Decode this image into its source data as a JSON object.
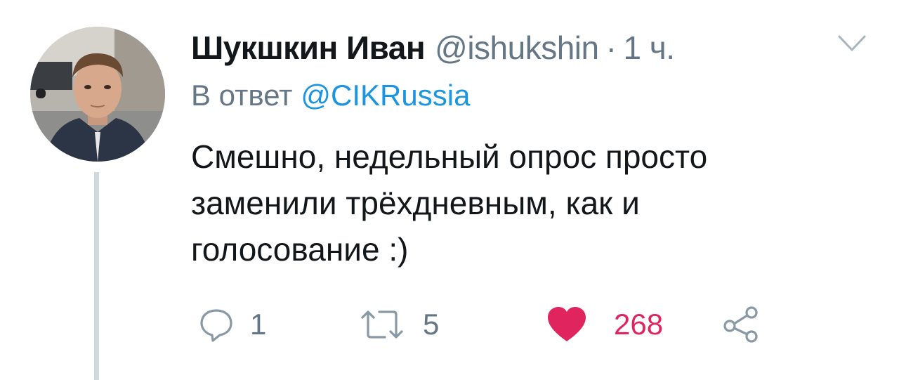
{
  "tweet": {
    "author": {
      "display_name": "Шукшкин Иван",
      "handle": "@ishukshin",
      "separator": "·",
      "time": "1 ч."
    },
    "reply_to": {
      "prefix": "В ответ",
      "mention": "@CIKRussia"
    },
    "text_lines": [
      "Смешно, недельный опрос просто",
      "заменили трёхдневным, как и",
      "голосование :)"
    ],
    "actions": {
      "reply": {
        "icon": "reply-icon",
        "count": "1"
      },
      "retweet": {
        "icon": "retweet-icon",
        "count": "5"
      },
      "like": {
        "icon": "heart-icon",
        "count": "268",
        "liked": true
      },
      "share": {
        "icon": "share-icon"
      }
    },
    "colors": {
      "text": "#14171a",
      "secondary": "#657786",
      "link": "#1b95e0",
      "like": "#e0245e",
      "thread_line": "#cfd9de"
    }
  }
}
